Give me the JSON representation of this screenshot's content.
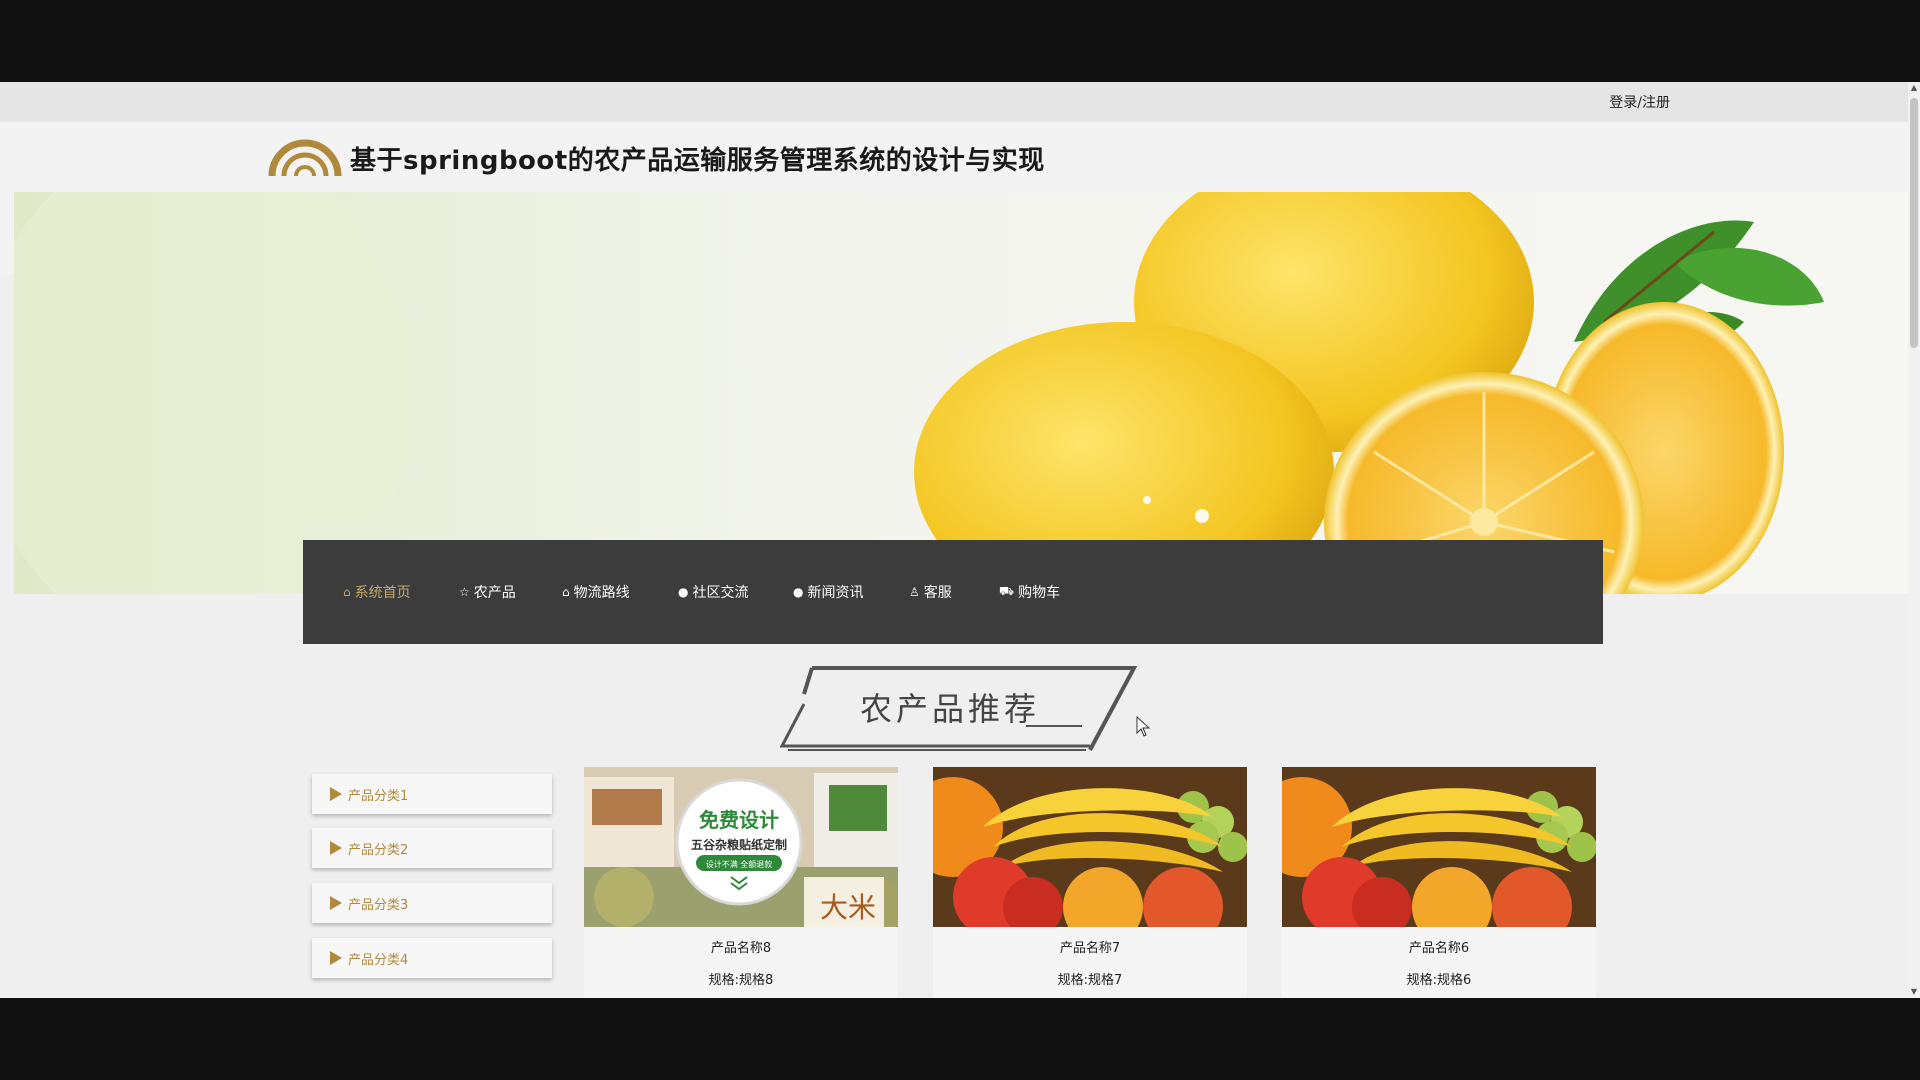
{
  "topbar": {
    "login_label": "登录/注册"
  },
  "header": {
    "title": "基于springboot的农产品运输服务管理系统的设计与实现"
  },
  "nav": {
    "items": [
      {
        "label": "系统首页",
        "icon": "home-icon",
        "active": true
      },
      {
        "label": "农产品",
        "icon": "star-icon",
        "active": false
      },
      {
        "label": "物流路线",
        "icon": "bag-icon",
        "active": false
      },
      {
        "label": "社区交流",
        "icon": "dot-icon",
        "active": false
      },
      {
        "label": "新闻资讯",
        "icon": "dot-icon",
        "active": false
      },
      {
        "label": "客服",
        "icon": "user-icon",
        "active": false
      },
      {
        "label": "购物车",
        "icon": "truck-icon",
        "active": false
      }
    ]
  },
  "section": {
    "title": "农产品推荐"
  },
  "categories": [
    "产品分类1",
    "产品分类2",
    "产品分类3",
    "产品分类4"
  ],
  "products": [
    {
      "name": "产品名称8",
      "spec": "规格:规格8",
      "image_text": {
        "line1": "免费设计",
        "line2": "五谷杂粮贴纸定制",
        "line3": "设计不满 全额退款",
        "bag_text": "大米"
      }
    },
    {
      "name": "产品名称7",
      "spec": "规格:规格7"
    },
    {
      "name": "产品名称6",
      "spec": "规格:规格6"
    }
  ],
  "colors": {
    "accent": "#c7a96a",
    "nav_bg": "#3c3c3c",
    "category_text": "#b08a3a"
  }
}
